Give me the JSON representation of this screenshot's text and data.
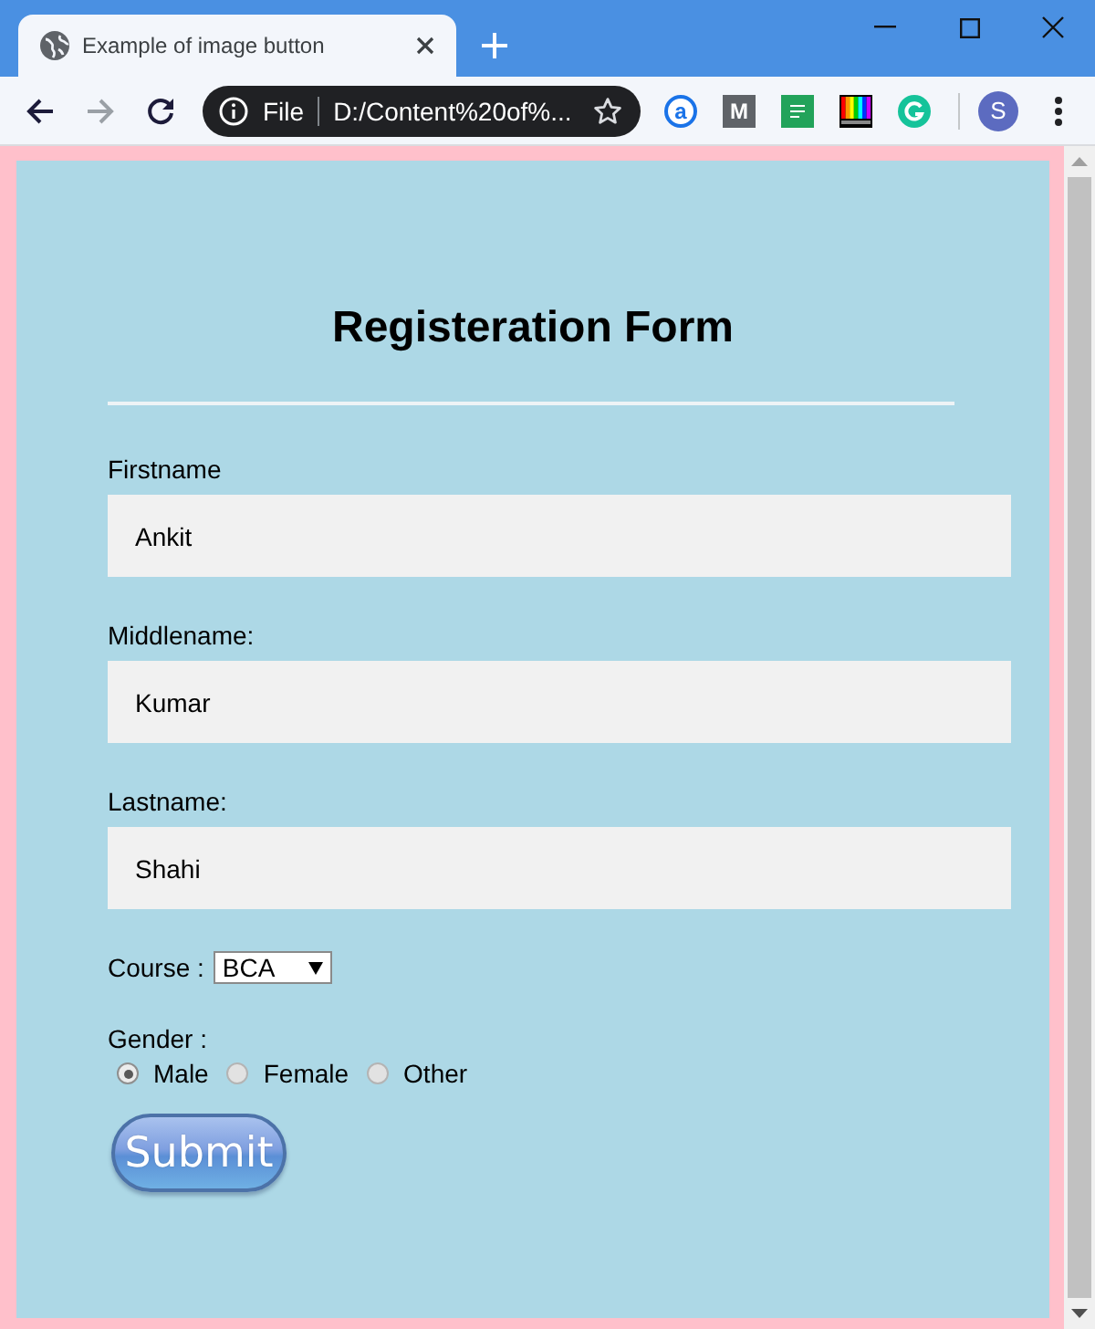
{
  "tab": {
    "title": "Example of image button"
  },
  "toolbar": {
    "nav_buttons": [
      {
        "kind": "back",
        "disabled": false
      },
      {
        "kind": "forward",
        "disabled": true
      },
      {
        "kind": "reload",
        "disabled": false
      }
    ],
    "address": {
      "scheme": "File",
      "url": "D:/Content%20of%..."
    },
    "extensions": [
      {
        "kind": "ring",
        "glyph": "a"
      },
      {
        "kind": "tile",
        "glyph": "M"
      },
      {
        "kind": "sheet"
      },
      {
        "kind": "bars"
      },
      {
        "kind": "arc"
      }
    ],
    "profile": {
      "initial": "S"
    }
  },
  "form": {
    "title": "Registeration Form",
    "fields": [
      {
        "label": "Firstname",
        "value": "Ankit"
      },
      {
        "label": "Middlename:",
        "value": "Kumar"
      },
      {
        "label": "Lastname:",
        "value": "Shahi"
      }
    ],
    "course": {
      "label": "Course :",
      "value": "BCA"
    },
    "gender": {
      "label": "Gender :",
      "options": [
        {
          "label": "Male",
          "selected": true
        },
        {
          "label": "Female",
          "selected": false
        },
        {
          "label": "Other",
          "selected": false
        }
      ]
    },
    "submit": {
      "label": "Submit"
    }
  }
}
